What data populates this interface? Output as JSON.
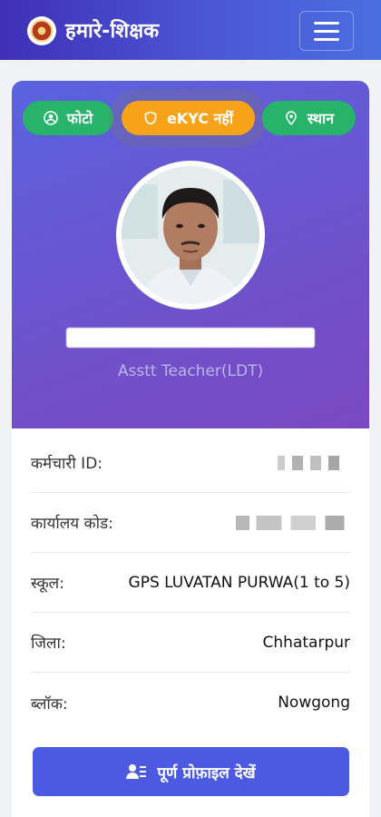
{
  "header": {
    "title": "हमारे-शिक्षक",
    "logo_icon": "emblem-logo",
    "menu_icon": "hamburger-menu-icon"
  },
  "profile": {
    "status_pills": [
      {
        "label": "फोटो",
        "icon": "user-circle-icon",
        "color": "#27b46a"
      },
      {
        "label": "eKYC नहीं",
        "icon": "shield-icon",
        "color": "#f6a31a"
      },
      {
        "label": "स्थान",
        "icon": "location-pin-icon",
        "color": "#27b46a"
      }
    ],
    "designation": "Asstt Teacher(LDT)"
  },
  "details": {
    "rows": [
      {
        "label": "कर्मचारी ID:",
        "value": ""
      },
      {
        "label": "कार्यालय कोड:",
        "value": ""
      },
      {
        "label": "स्कूल:",
        "value": "GPS LUVATAN PURWA(1 to 5)"
      },
      {
        "label": "जिला:",
        "value": "Chhatarpur"
      },
      {
        "label": "ब्लॉक:",
        "value": "Nowgong"
      }
    ],
    "cta_label": "पूर्ण प्रोफ़ाइल देखें",
    "cta_icon": "user-list-icon"
  },
  "colors": {
    "header": "#4b57d6",
    "accent": "#4b5ae0",
    "success": "#27b46a",
    "warning": "#f6a31a"
  }
}
